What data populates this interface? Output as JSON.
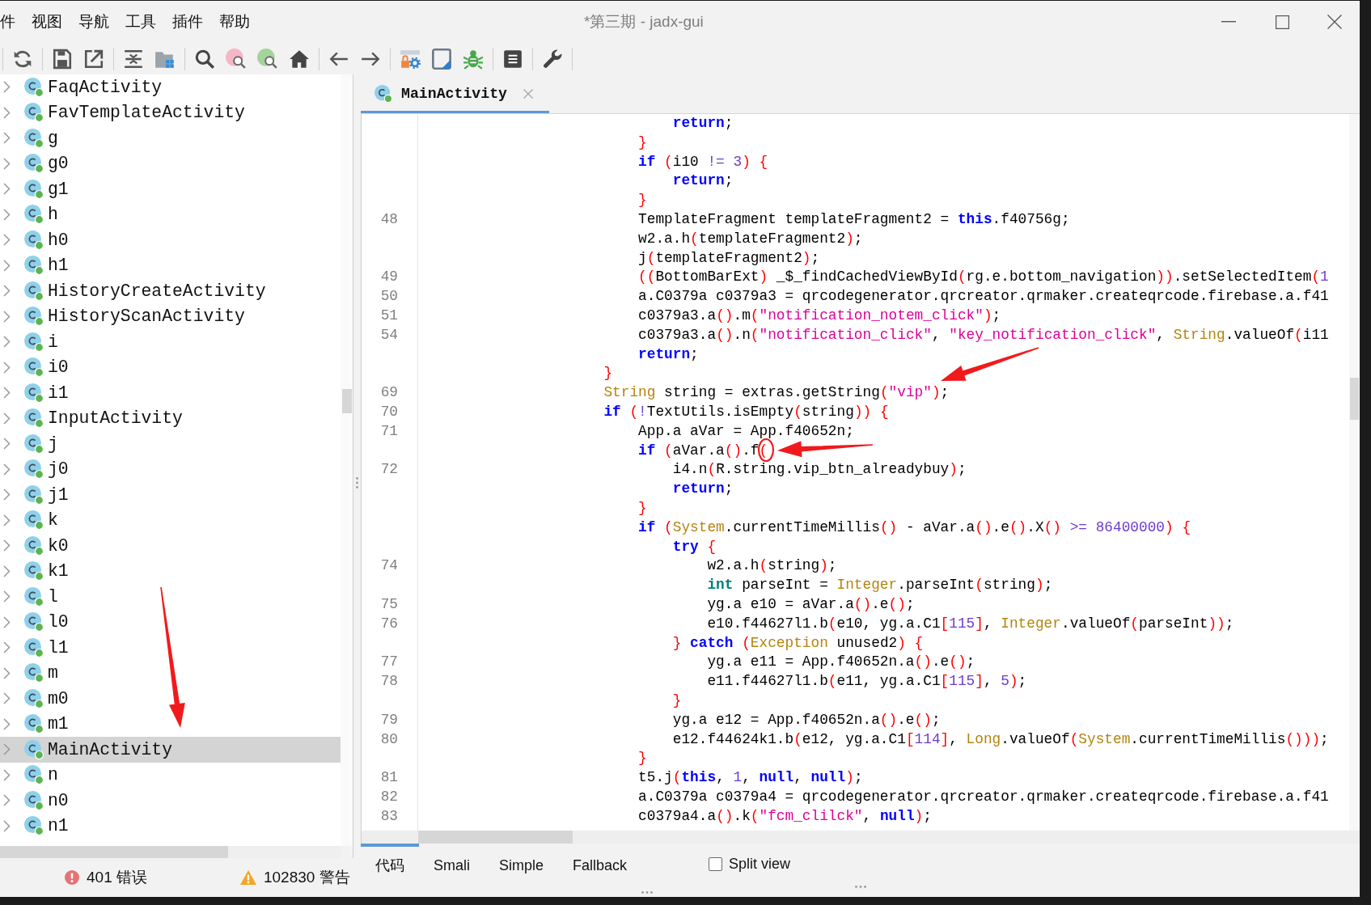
{
  "window": {
    "title": "*第三期 - jadx-gui"
  },
  "menu": [
    "件",
    "视图",
    "导航",
    "工具",
    "插件",
    "帮助"
  ],
  "tree": {
    "items": [
      {
        "label": "FaqActivity",
        "expanded": false,
        "selected": false
      },
      {
        "label": "FavTemplateActivity",
        "expanded": false,
        "selected": false
      },
      {
        "label": "g",
        "expanded": false,
        "selected": false
      },
      {
        "label": "g0",
        "expanded": false,
        "selected": false
      },
      {
        "label": "g1",
        "expanded": false,
        "selected": false
      },
      {
        "label": "h",
        "expanded": false,
        "selected": false
      },
      {
        "label": "h0",
        "expanded": false,
        "selected": false
      },
      {
        "label": "h1",
        "expanded": false,
        "selected": false
      },
      {
        "label": "HistoryCreateActivity",
        "expanded": false,
        "selected": false
      },
      {
        "label": "HistoryScanActivity",
        "expanded": false,
        "selected": false
      },
      {
        "label": "i",
        "expanded": false,
        "selected": false
      },
      {
        "label": "i0",
        "expanded": false,
        "selected": false
      },
      {
        "label": "i1",
        "expanded": false,
        "selected": false
      },
      {
        "label": "InputActivity",
        "expanded": false,
        "selected": false
      },
      {
        "label": "j",
        "expanded": false,
        "selected": false
      },
      {
        "label": "j0",
        "expanded": false,
        "selected": false
      },
      {
        "label": "j1",
        "expanded": false,
        "selected": false
      },
      {
        "label": "k",
        "expanded": false,
        "selected": false
      },
      {
        "label": "k0",
        "expanded": false,
        "selected": false
      },
      {
        "label": "k1",
        "expanded": false,
        "selected": false
      },
      {
        "label": "l",
        "expanded": false,
        "selected": false
      },
      {
        "label": "l0",
        "expanded": false,
        "selected": false
      },
      {
        "label": "l1",
        "expanded": false,
        "selected": false
      },
      {
        "label": "m",
        "expanded": false,
        "selected": false
      },
      {
        "label": "m0",
        "expanded": false,
        "selected": false
      },
      {
        "label": "m1",
        "expanded": false,
        "selected": false
      },
      {
        "label": "MainActivity",
        "expanded": false,
        "selected": true
      },
      {
        "label": "n",
        "expanded": false,
        "selected": false
      },
      {
        "label": "n0",
        "expanded": false,
        "selected": false
      },
      {
        "label": "n1",
        "expanded": false,
        "selected": false
      }
    ]
  },
  "editor_tabs": [
    {
      "label": "MainActivity",
      "selected": true
    }
  ],
  "code": {
    "lines": [
      {
        "children": [
          {
            "children": [
              {
                "tokens": [
                  {
                    "kind": "keyword",
                    "text": "return"
                  },
                  {
                    "kind": "plain",
                    "text": ";"
                  }
                ]
              }
            ]
          },
          {
            "tokens": [
              {
                "kind": "bracket",
                "text": "}"
              }
            ]
          },
          {
            "tokens": [
              {
                "kind": "keyword",
                "text": "if "
              },
              {
                "kind": "bracket",
                "text": "("
              },
              {
                "kind": "plain",
                "text": "i10 "
              },
              {
                "kind": "operator",
                "text": "!= "
              },
              {
                "kind": "number",
                "text": "3"
              },
              {
                "kind": "bracket",
                "text": ") {"
              }
            ],
            "children": [
              {
                "tokens": [
                  {
                    "kind": "keyword",
                    "text": "return"
                  },
                  {
                    "kind": "plain",
                    "text": ";"
                  }
                ]
              }
            ]
          },
          {
            "tokens": [
              {
                "kind": "bracket",
                "text": "}"
              }
            ]
          },
          {
            "number": "48",
            "tokens": [
              {
                "kind": "plain",
                "text": "TemplateFragment templateFragment2 = "
              },
              {
                "kind": "keyword",
                "text": "this"
              },
              {
                "kind": "plain",
                "text": ".f40756g;"
              }
            ]
          },
          {
            "tokens": [
              {
                "kind": "plain",
                "text": "w2.a.h"
              },
              {
                "kind": "bracket",
                "text": "("
              },
              {
                "kind": "plain",
                "text": "templateFragment2"
              },
              {
                "kind": "bracket",
                "text": ")"
              },
              {
                "kind": "plain",
                "text": ";"
              }
            ]
          },
          {
            "tokens": [
              {
                "kind": "plain",
                "text": "j"
              },
              {
                "kind": "bracket",
                "text": "("
              },
              {
                "kind": "plain",
                "text": "templateFragment2"
              },
              {
                "kind": "bracket",
                "text": ")"
              },
              {
                "kind": "plain",
                "text": ";"
              }
            ]
          },
          {
            "number": "49",
            "tokens": [
              {
                "kind": "bracket",
                "text": "(("
              },
              {
                "kind": "plain",
                "text": "BottomBarExt"
              },
              {
                "kind": "bracket",
                "text": ")"
              },
              {
                "kind": "plain",
                "text": " _$_findCachedViewById"
              },
              {
                "kind": "bracket",
                "text": "("
              },
              {
                "kind": "plain",
                "text": "rg.e.bottom_navigation"
              },
              {
                "kind": "bracket",
                "text": "))"
              },
              {
                "kind": "plain",
                "text": ".setSelectedItem"
              },
              {
                "kind": "bracket",
                "text": "("
              },
              {
                "kind": "number",
                "text": "1"
              }
            ]
          },
          {
            "number": "50",
            "tokens": [
              {
                "kind": "plain",
                "text": "a.C0379a c0379a3 = qrcodegenerator.qrcreator.qrmaker.createqrcode.firebase.a.f41"
              }
            ]
          },
          {
            "number": "51",
            "tokens": [
              {
                "kind": "plain",
                "text": "c0379a3.a"
              },
              {
                "kind": "bracket",
                "text": "()"
              },
              {
                "kind": "plain",
                "text": ".m"
              },
              {
                "kind": "bracket",
                "text": "("
              },
              {
                "kind": "string",
                "text": "\"notification_notem_click\""
              },
              {
                "kind": "bracket",
                "text": ")"
              },
              {
                "kind": "plain",
                "text": ";"
              }
            ]
          },
          {
            "number": "54",
            "tokens": [
              {
                "kind": "plain",
                "text": "c0379a3.a"
              },
              {
                "kind": "bracket",
                "text": "()"
              },
              {
                "kind": "plain",
                "text": ".n"
              },
              {
                "kind": "bracket",
                "text": "("
              },
              {
                "kind": "string",
                "text": "\"notification_click\""
              },
              {
                "kind": "plain",
                "text": ", "
              },
              {
                "kind": "string",
                "text": "\"key_notification_click\""
              },
              {
                "kind": "plain",
                "text": ", "
              },
              {
                "kind": "type",
                "text": "String"
              },
              {
                "kind": "plain",
                "text": ".valueOf"
              },
              {
                "kind": "bracket",
                "text": "("
              },
              {
                "kind": "plain",
                "text": "i11"
              }
            ]
          },
          {
            "tokens": [
              {
                "kind": "keyword",
                "text": "return"
              },
              {
                "kind": "plain",
                "text": ";"
              }
            ]
          }
        ]
      },
      {
        "tokens": [
          {
            "kind": "bracket",
            "text": "}"
          }
        ]
      },
      {
        "number": "69",
        "tokens": [
          {
            "kind": "type",
            "text": "String"
          },
          {
            "kind": "plain",
            "text": " string = extras.getString"
          },
          {
            "kind": "bracket",
            "text": "("
          },
          {
            "kind": "string",
            "text": "\"vip\""
          },
          {
            "kind": "bracket",
            "text": ")"
          },
          {
            "kind": "plain",
            "text": ";"
          }
        ]
      },
      {
        "number": "70",
        "tokens": [
          {
            "kind": "keyword",
            "text": "if "
          },
          {
            "kind": "bracket",
            "text": "("
          },
          {
            "kind": "operator",
            "text": "!"
          },
          {
            "kind": "plain",
            "text": "TextUtils.isEmpty"
          },
          {
            "kind": "bracket",
            "text": "("
          },
          {
            "kind": "plain",
            "text": "string"
          },
          {
            "kind": "bracket",
            "text": ")) {"
          }
        ],
        "children": [
          {
            "number": "71",
            "tokens": [
              {
                "kind": "plain",
                "text": "App.a aVar = App.f40652n;"
              }
            ]
          },
          {
            "tokens": [
              {
                "kind": "keyword",
                "text": "if "
              },
              {
                "kind": "bracket",
                "text": "("
              },
              {
                "kind": "plain",
                "text": "aVar.a"
              },
              {
                "kind": "bracket",
                "text": "()"
              },
              {
                "kind": "plain",
                "text": ".f"
              },
              {
                "kind": "bracket",
                "text": "("
              }
            ],
            "children": [
              {
                "number": "72",
                "tokens": [
                  {
                    "kind": "plain",
                    "text": "i4.n"
                  },
                  {
                    "kind": "bracket",
                    "text": "("
                  },
                  {
                    "kind": "plain",
                    "text": "R.string.vip_btn_alreadybuy"
                  },
                  {
                    "kind": "bracket",
                    "text": ")"
                  },
                  {
                    "kind": "plain",
                    "text": ";"
                  }
                ]
              },
              {
                "tokens": [
                  {
                    "kind": "keyword",
                    "text": "return"
                  },
                  {
                    "kind": "plain",
                    "text": ";"
                  }
                ]
              }
            ]
          },
          {
            "tokens": [
              {
                "kind": "bracket",
                "text": "}"
              }
            ]
          },
          {
            "tokens": [
              {
                "kind": "keyword",
                "text": "if "
              },
              {
                "kind": "bracket",
                "text": "("
              },
              {
                "kind": "type",
                "text": "System"
              },
              {
                "kind": "plain",
                "text": ".currentTimeMillis"
              },
              {
                "kind": "bracket",
                "text": "()"
              },
              {
                "kind": "plain",
                "text": " - aVar.a"
              },
              {
                "kind": "bracket",
                "text": "()"
              },
              {
                "kind": "plain",
                "text": ".e"
              },
              {
                "kind": "bracket",
                "text": "()"
              },
              {
                "kind": "plain",
                "text": ".X"
              },
              {
                "kind": "bracket",
                "text": "()"
              },
              {
                "kind": "operator",
                "text": " >= "
              },
              {
                "kind": "number",
                "text": "86400000"
              },
              {
                "kind": "bracket",
                "text": ") {"
              }
            ],
            "children": [
              {
                "tokens": [
                  {
                    "kind": "keyword",
                    "text": "try "
                  },
                  {
                    "kind": "bracket",
                    "text": "{"
                  }
                ],
                "children": [
                  {
                    "number": "74",
                    "tokens": [
                      {
                        "kind": "plain",
                        "text": "w2.a.h"
                      },
                      {
                        "kind": "bracket",
                        "text": "("
                      },
                      {
                        "kind": "plain",
                        "text": "string"
                      },
                      {
                        "kind": "bracket",
                        "text": ")"
                      },
                      {
                        "kind": "plain",
                        "text": ";"
                      }
                    ]
                  },
                  {
                    "tokens": [
                      {
                        "kind": "primitive",
                        "text": "int"
                      },
                      {
                        "kind": "plain",
                        "text": " parseInt = "
                      },
                      {
                        "kind": "type",
                        "text": "Integer"
                      },
                      {
                        "kind": "plain",
                        "text": ".parseInt"
                      },
                      {
                        "kind": "bracket",
                        "text": "("
                      },
                      {
                        "kind": "plain",
                        "text": "string"
                      },
                      {
                        "kind": "bracket",
                        "text": ")"
                      },
                      {
                        "kind": "plain",
                        "text": ";"
                      }
                    ]
                  },
                  {
                    "number": "75",
                    "tokens": [
                      {
                        "kind": "plain",
                        "text": "yg.a e10 = aVar.a"
                      },
                      {
                        "kind": "bracket",
                        "text": "()"
                      },
                      {
                        "kind": "plain",
                        "text": ".e"
                      },
                      {
                        "kind": "bracket",
                        "text": "()"
                      },
                      {
                        "kind": "plain",
                        "text": ";"
                      }
                    ]
                  },
                  {
                    "number": "76",
                    "tokens": [
                      {
                        "kind": "plain",
                        "text": "e10.f44627l1.b"
                      },
                      {
                        "kind": "bracket",
                        "text": "("
                      },
                      {
                        "kind": "plain",
                        "text": "e10, yg.a.C1"
                      },
                      {
                        "kind": "bracket",
                        "text": "["
                      },
                      {
                        "kind": "number",
                        "text": "115"
                      },
                      {
                        "kind": "bracket",
                        "text": "]"
                      },
                      {
                        "kind": "plain",
                        "text": ", "
                      },
                      {
                        "kind": "type",
                        "text": "Integer"
                      },
                      {
                        "kind": "plain",
                        "text": ".valueOf"
                      },
                      {
                        "kind": "bracket",
                        "text": "("
                      },
                      {
                        "kind": "plain",
                        "text": "parseInt"
                      },
                      {
                        "kind": "bracket",
                        "text": "))"
                      },
                      {
                        "kind": "plain",
                        "text": ";"
                      }
                    ]
                  }
                ]
              },
              {
                "tokens": [
                  {
                    "kind": "bracket",
                    "text": "} "
                  },
                  {
                    "kind": "keyword",
                    "text": "catch "
                  },
                  {
                    "kind": "bracket",
                    "text": "("
                  },
                  {
                    "kind": "type",
                    "text": "Exception"
                  },
                  {
                    "kind": "plain",
                    "text": " unused2"
                  },
                  {
                    "kind": "bracket",
                    "text": ") {"
                  }
                ],
                "children": [
                  {
                    "number": "77",
                    "tokens": [
                      {
                        "kind": "plain",
                        "text": "yg.a e11 = App.f40652n.a"
                      },
                      {
                        "kind": "bracket",
                        "text": "()"
                      },
                      {
                        "kind": "plain",
                        "text": ".e"
                      },
                      {
                        "kind": "bracket",
                        "text": "()"
                      },
                      {
                        "kind": "plain",
                        "text": ";"
                      }
                    ]
                  },
                  {
                    "number": "78",
                    "tokens": [
                      {
                        "kind": "plain",
                        "text": "e11.f44627l1.b"
                      },
                      {
                        "kind": "bracket",
                        "text": "("
                      },
                      {
                        "kind": "plain",
                        "text": "e11, yg.a.C1"
                      },
                      {
                        "kind": "bracket",
                        "text": "["
                      },
                      {
                        "kind": "number",
                        "text": "115"
                      },
                      {
                        "kind": "bracket",
                        "text": "]"
                      },
                      {
                        "kind": "plain",
                        "text": ", "
                      },
                      {
                        "kind": "number",
                        "text": "5"
                      },
                      {
                        "kind": "bracket",
                        "text": ")"
                      },
                      {
                        "kind": "plain",
                        "text": ";"
                      }
                    ]
                  }
                ]
              },
              {
                "tokens": [
                  {
                    "kind": "bracket",
                    "text": "}"
                  }
                ]
              },
              {
                "number": "79",
                "tokens": [
                  {
                    "kind": "plain",
                    "text": "yg.a e12 = App.f40652n.a"
                  },
                  {
                    "kind": "bracket",
                    "text": "()"
                  },
                  {
                    "kind": "plain",
                    "text": ".e"
                  },
                  {
                    "kind": "bracket",
                    "text": "()"
                  },
                  {
                    "kind": "plain",
                    "text": ";"
                  }
                ]
              },
              {
                "number": "80",
                "tokens": [
                  {
                    "kind": "plain",
                    "text": "e12.f44624k1.b"
                  },
                  {
                    "kind": "bracket",
                    "text": "("
                  },
                  {
                    "kind": "plain",
                    "text": "e12, yg.a.C1"
                  },
                  {
                    "kind": "bracket",
                    "text": "["
                  },
                  {
                    "kind": "number",
                    "text": "114"
                  },
                  {
                    "kind": "bracket",
                    "text": "]"
                  },
                  {
                    "kind": "plain",
                    "text": ", "
                  },
                  {
                    "kind": "type",
                    "text": "Long"
                  },
                  {
                    "kind": "plain",
                    "text": ".valueOf"
                  },
                  {
                    "kind": "bracket",
                    "text": "("
                  },
                  {
                    "kind": "type",
                    "text": "System"
                  },
                  {
                    "kind": "plain",
                    "text": ".currentTimeMillis"
                  },
                  {
                    "kind": "bracket",
                    "text": "()))"
                  },
                  {
                    "kind": "plain",
                    "text": ";"
                  }
                ]
              }
            ]
          },
          {
            "tokens": [
              {
                "kind": "bracket",
                "text": "}"
              }
            ]
          },
          {
            "number": "81",
            "tokens": [
              {
                "kind": "plain",
                "text": "t5.j"
              },
              {
                "kind": "bracket",
                "text": "("
              },
              {
                "kind": "keyword",
                "text": "this"
              },
              {
                "kind": "plain",
                "text": ", "
              },
              {
                "kind": "number",
                "text": "1"
              },
              {
                "kind": "plain",
                "text": ", "
              },
              {
                "kind": "keyword",
                "text": "null"
              },
              {
                "kind": "plain",
                "text": ", "
              },
              {
                "kind": "keyword",
                "text": "null"
              },
              {
                "kind": "bracket",
                "text": ")"
              },
              {
                "kind": "plain",
                "text": ";"
              }
            ]
          },
          {
            "number": "82",
            "tokens": [
              {
                "kind": "plain",
                "text": "a.C0379a c0379a4 = qrcodegenerator.qrcreator.qrmaker.createqrcode.firebase.a.f41"
              }
            ]
          },
          {
            "number": "83",
            "tokens": [
              {
                "kind": "plain",
                "text": "c0379a4.a"
              },
              {
                "kind": "bracket",
                "text": "()"
              },
              {
                "kind": "plain",
                "text": ".k"
              },
              {
                "kind": "bracket",
                "text": "("
              },
              {
                "kind": "string",
                "text": "\"fcm_clilck\""
              },
              {
                "kind": "plain",
                "text": ", "
              },
              {
                "kind": "keyword",
                "text": "null"
              },
              {
                "kind": "bracket",
                "text": ")"
              },
              {
                "kind": "plain",
                "text": ";"
              }
            ]
          }
        ]
      }
    ]
  },
  "view_tabs": [
    {
      "label": "代码",
      "selected": true
    },
    {
      "label": "Smali",
      "selected": false
    },
    {
      "label": "Simple",
      "selected": false
    },
    {
      "label": "Fallback",
      "selected": false
    }
  ],
  "split_view": {
    "label": "Split view",
    "checked": false
  },
  "status_bar": {
    "errors": "401 错误",
    "warnings": "102830 警告"
  }
}
